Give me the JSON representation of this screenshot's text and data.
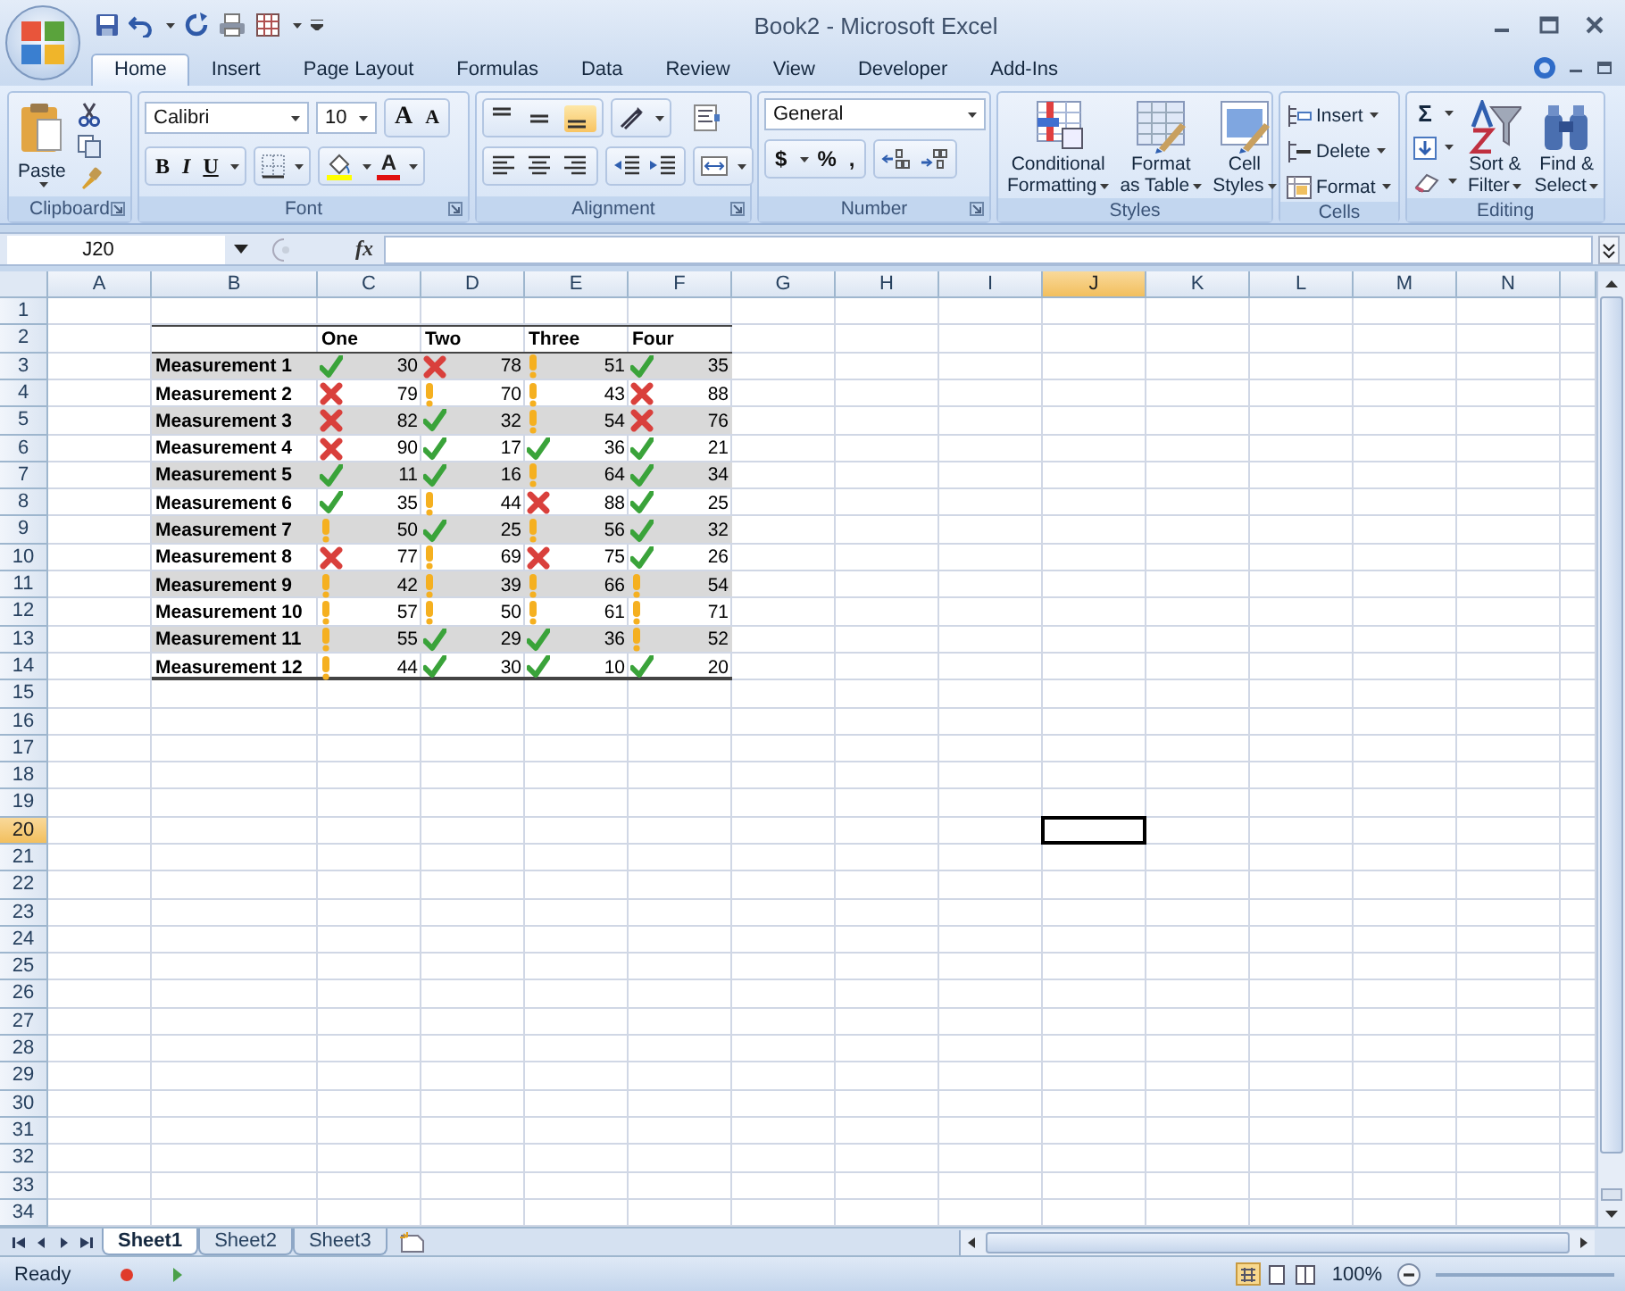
{
  "window": {
    "title": "Book2 - Microsoft Excel"
  },
  "ribbon": {
    "tabs": [
      {
        "label": "Home",
        "selected": true
      },
      {
        "label": "Insert",
        "selected": false
      },
      {
        "label": "Page Layout",
        "selected": false
      },
      {
        "label": "Formulas",
        "selected": false
      },
      {
        "label": "Data",
        "selected": false
      },
      {
        "label": "Review",
        "selected": false
      },
      {
        "label": "View",
        "selected": false
      },
      {
        "label": "Developer",
        "selected": false
      },
      {
        "label": "Add-Ins",
        "selected": false
      }
    ],
    "groups": [
      {
        "kind": "clipboard",
        "label": "Clipboard",
        "paste": "Paste"
      },
      {
        "kind": "font",
        "label": "Font",
        "font_name": "Calibri",
        "font_size": "10",
        "size_buttons": [
          "A",
          "A"
        ],
        "style_buttons": [
          "B",
          "I",
          "U"
        ],
        "font_color": "A"
      },
      {
        "kind": "alignment",
        "label": "Alignment",
        "vertical_align": [
          {
            "selected": false
          },
          {
            "selected": false
          },
          {
            "selected": true
          }
        ]
      },
      {
        "kind": "number",
        "label": "Number",
        "format": "General",
        "buttons": [
          "$",
          "%",
          ","
        ]
      },
      {
        "kind": "styles",
        "label": "Styles",
        "buttons": [
          {
            "lines": [
              "Conditional",
              "Formatting"
            ]
          },
          {
            "lines": [
              "Format",
              "as Table"
            ]
          },
          {
            "lines": [
              "Cell",
              "Styles"
            ]
          }
        ]
      },
      {
        "kind": "cells",
        "label": "Cells",
        "buttons": [
          "Insert",
          "Delete",
          "Format"
        ]
      },
      {
        "kind": "editing",
        "label": "Editing",
        "sum": "Σ",
        "buttons": [
          {
            "lines": [
              "Sort &",
              "Filter"
            ]
          },
          {
            "lines": [
              "Find &",
              "Select"
            ]
          }
        ]
      }
    ]
  },
  "formula_bar": {
    "name_box": "J20",
    "function_label": "fx"
  },
  "sheet": {
    "columns": [
      {
        "label": "A",
        "selected": false
      },
      {
        "label": "B",
        "selected": false
      },
      {
        "label": "C",
        "selected": false
      },
      {
        "label": "D",
        "selected": false
      },
      {
        "label": "E",
        "selected": false
      },
      {
        "label": "F",
        "selected": false
      },
      {
        "label": "G",
        "selected": false
      },
      {
        "label": "H",
        "selected": false
      },
      {
        "label": "I",
        "selected": false
      },
      {
        "label": "J",
        "selected": true
      },
      {
        "label": "K",
        "selected": false
      },
      {
        "label": "L",
        "selected": false
      },
      {
        "label": "M",
        "selected": false
      },
      {
        "label": "N",
        "selected": false
      }
    ],
    "rows": [
      {
        "label": "1",
        "selected": false
      },
      {
        "label": "2",
        "selected": false
      },
      {
        "label": "3",
        "selected": false
      },
      {
        "label": "4",
        "selected": false
      },
      {
        "label": "5",
        "selected": false
      },
      {
        "label": "6",
        "selected": false
      },
      {
        "label": "7",
        "selected": false
      },
      {
        "label": "8",
        "selected": false
      },
      {
        "label": "9",
        "selected": false
      },
      {
        "label": "10",
        "selected": false
      },
      {
        "label": "11",
        "selected": false
      },
      {
        "label": "12",
        "selected": false
      },
      {
        "label": "13",
        "selected": false
      },
      {
        "label": "14",
        "selected": false
      },
      {
        "label": "15",
        "selected": false
      },
      {
        "label": "16",
        "selected": false
      },
      {
        "label": "17",
        "selected": false
      },
      {
        "label": "18",
        "selected": false
      },
      {
        "label": "19",
        "selected": false
      },
      {
        "label": "20",
        "selected": true
      },
      {
        "label": "21",
        "selected": false
      },
      {
        "label": "22",
        "selected": false
      },
      {
        "label": "23",
        "selected": false
      },
      {
        "label": "24",
        "selected": false
      },
      {
        "label": "25",
        "selected": false
      },
      {
        "label": "26",
        "selected": false
      },
      {
        "label": "27",
        "selected": false
      },
      {
        "label": "28",
        "selected": false
      },
      {
        "label": "29",
        "selected": false
      },
      {
        "label": "30",
        "selected": false
      },
      {
        "label": "31",
        "selected": false
      },
      {
        "label": "32",
        "selected": false
      },
      {
        "label": "33",
        "selected": false
      },
      {
        "label": "34",
        "selected": false
      }
    ],
    "table": {
      "headers": [
        "One",
        "Two",
        "Three",
        "Four"
      ],
      "rows": [
        {
          "label": "Measurement 1",
          "shaded": true,
          "cells": [
            {
              "kind": "good",
              "value": "30"
            },
            {
              "kind": "bad",
              "value": "78"
            },
            {
              "kind": "warning",
              "value": "51"
            },
            {
              "kind": "good",
              "value": "35"
            }
          ]
        },
        {
          "label": "Measurement 2",
          "shaded": false,
          "cells": [
            {
              "kind": "bad",
              "value": "79"
            },
            {
              "kind": "warning",
              "value": "70"
            },
            {
              "kind": "warning",
              "value": "43"
            },
            {
              "kind": "bad",
              "value": "88"
            }
          ]
        },
        {
          "label": "Measurement 3",
          "shaded": true,
          "cells": [
            {
              "kind": "bad",
              "value": "82"
            },
            {
              "kind": "good",
              "value": "32"
            },
            {
              "kind": "warning",
              "value": "54"
            },
            {
              "kind": "bad",
              "value": "76"
            }
          ]
        },
        {
          "label": "Measurement 4",
          "shaded": false,
          "cells": [
            {
              "kind": "bad",
              "value": "90"
            },
            {
              "kind": "good",
              "value": "17"
            },
            {
              "kind": "good",
              "value": "36"
            },
            {
              "kind": "good",
              "value": "21"
            }
          ]
        },
        {
          "label": "Measurement 5",
          "shaded": true,
          "cells": [
            {
              "kind": "good",
              "value": "11"
            },
            {
              "kind": "good",
              "value": "16"
            },
            {
              "kind": "warning",
              "value": "64"
            },
            {
              "kind": "good",
              "value": "34"
            }
          ]
        },
        {
          "label": "Measurement 6",
          "shaded": false,
          "cells": [
            {
              "kind": "good",
              "value": "35"
            },
            {
              "kind": "warning",
              "value": "44"
            },
            {
              "kind": "bad",
              "value": "88"
            },
            {
              "kind": "good",
              "value": "25"
            }
          ]
        },
        {
          "label": "Measurement 7",
          "shaded": true,
          "cells": [
            {
              "kind": "warning",
              "value": "50"
            },
            {
              "kind": "good",
              "value": "25"
            },
            {
              "kind": "warning",
              "value": "56"
            },
            {
              "kind": "good",
              "value": "32"
            }
          ]
        },
        {
          "label": "Measurement 8",
          "shaded": false,
          "cells": [
            {
              "kind": "bad",
              "value": "77"
            },
            {
              "kind": "warning",
              "value": "69"
            },
            {
              "kind": "bad",
              "value": "75"
            },
            {
              "kind": "good",
              "value": "26"
            }
          ]
        },
        {
          "label": "Measurement 9",
          "shaded": true,
          "cells": [
            {
              "kind": "warning",
              "value": "42"
            },
            {
              "kind": "warning",
              "value": "39"
            },
            {
              "kind": "warning",
              "value": "66"
            },
            {
              "kind": "warning",
              "value": "54"
            }
          ]
        },
        {
          "label": "Measurement 10",
          "shaded": false,
          "cells": [
            {
              "kind": "warning",
              "value": "57"
            },
            {
              "kind": "warning",
              "value": "50"
            },
            {
              "kind": "warning",
              "value": "61"
            },
            {
              "kind": "warning",
              "value": "71"
            }
          ]
        },
        {
          "label": "Measurement 11",
          "shaded": true,
          "cells": [
            {
              "kind": "warning",
              "value": "55"
            },
            {
              "kind": "good",
              "value": "29"
            },
            {
              "kind": "good",
              "value": "36"
            },
            {
              "kind": "warning",
              "value": "52"
            }
          ]
        },
        {
          "label": "Measurement 12",
          "shaded": false,
          "cells": [
            {
              "kind": "warning",
              "value": "44"
            },
            {
              "kind": "good",
              "value": "30"
            },
            {
              "kind": "good",
              "value": "10"
            },
            {
              "kind": "good",
              "value": "20"
            }
          ]
        }
      ]
    }
  },
  "sheet_tabs": [
    {
      "label": "Sheet1",
      "selected": true
    },
    {
      "label": "Sheet2",
      "selected": false
    },
    {
      "label": "Sheet3",
      "selected": false
    }
  ],
  "status_bar": {
    "mode": "Ready",
    "zoom": "100%"
  }
}
